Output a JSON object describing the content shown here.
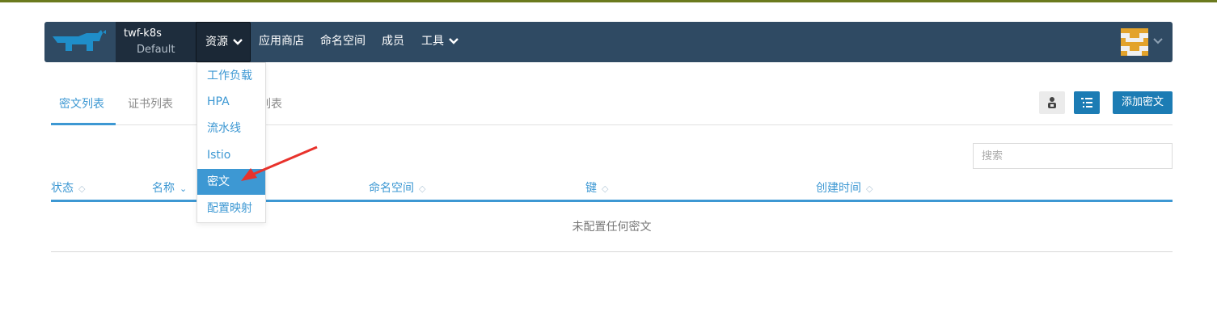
{
  "header": {
    "cluster": {
      "name": "twf-k8s",
      "project": "Default"
    },
    "nav": [
      {
        "label": "资源",
        "has_dropdown": true,
        "active": true
      },
      {
        "label": "应用商店"
      },
      {
        "label": "命名空间"
      },
      {
        "label": "成员"
      },
      {
        "label": "工具",
        "has_dropdown": true
      }
    ]
  },
  "dropdown": {
    "items": [
      "工作负载",
      "HPA",
      "流水线",
      "Istio",
      "密文",
      "配置映射"
    ],
    "selected": "密文"
  },
  "tabs": [
    "密文列表",
    "证书列表",
    "列表"
  ],
  "toolbar": {
    "add_label": "添加密文"
  },
  "search": {
    "placeholder": "搜索"
  },
  "table": {
    "columns": [
      "状态",
      "名称",
      "命名空间",
      "键",
      "创建时间"
    ],
    "empty_text": "未配置任何密文"
  },
  "colors": {
    "accent": "#3d98d3",
    "navbar": "#2f4a63",
    "primary_button": "#1c7cb4"
  }
}
